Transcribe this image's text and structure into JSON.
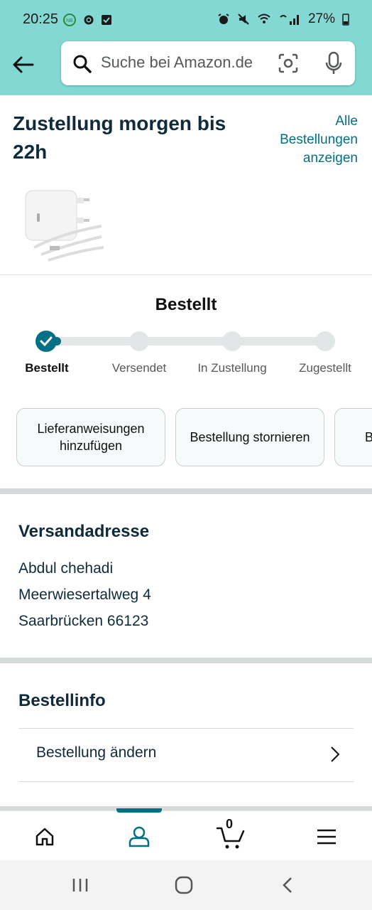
{
  "status_bar": {
    "time": "20:25",
    "battery": "27%"
  },
  "search": {
    "placeholder": "Suche bei Amazon.de"
  },
  "delivery": {
    "title": "Zustellung morgen bis 22h",
    "all_orders_link": "Alle Bestellungen anzeigen"
  },
  "tracking": {
    "heading": "Bestellt",
    "progress": 0.05,
    "steps": [
      {
        "label": "Bestellt",
        "active": true
      },
      {
        "label": "Versendet",
        "active": false
      },
      {
        "label": "In Zustellung",
        "active": false
      },
      {
        "label": "Zugestellt",
        "active": false
      }
    ],
    "actions": [
      {
        "label": "Lieferanweisungen hinzufügen"
      },
      {
        "label": "Bestellung stornieren"
      },
      {
        "label": "B"
      }
    ]
  },
  "address": {
    "heading": "Versandadresse",
    "lines": [
      "Abdul chehadi",
      "Meerwiesertalweg 4",
      "Saarbrücken 66123"
    ]
  },
  "order_info": {
    "heading": "Bestellinfo",
    "change_order": "Bestellung ändern"
  },
  "bottom_nav": {
    "cart_count": "0",
    "active_tab": "account"
  },
  "colors": {
    "header_bg": "#84d8d3",
    "accent": "#007185",
    "heading_text": "#0f2a3a"
  }
}
